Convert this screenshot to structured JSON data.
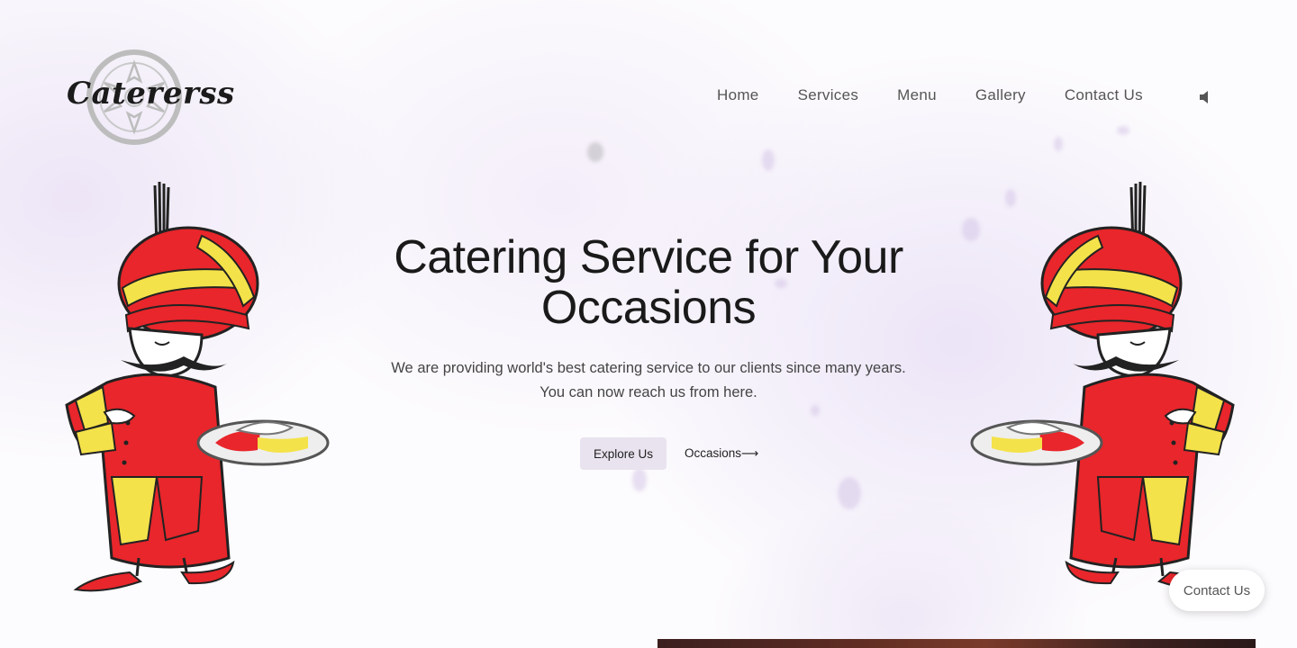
{
  "brand": {
    "name": "Catererss"
  },
  "nav": {
    "items": [
      {
        "label": "Home"
      },
      {
        "label": "Services"
      },
      {
        "label": "Menu"
      },
      {
        "label": "Gallery"
      },
      {
        "label": "Contact Us"
      }
    ],
    "sound_icon": "speaker-icon"
  },
  "hero": {
    "title": "Catering Service for Your Occasions",
    "subtitle": "We are providing world's best catering service to our clients since many years. You can now reach us from here.",
    "primary_button": "Explore Us",
    "secondary_link": "Occasions⟶"
  },
  "floating": {
    "contact_label": "Contact Us"
  },
  "colors": {
    "accent_bg": "#e9e3ef",
    "background_tint": "#ece3f6",
    "chef_red": "#e8262b",
    "chef_yellow": "#f4e24a"
  }
}
